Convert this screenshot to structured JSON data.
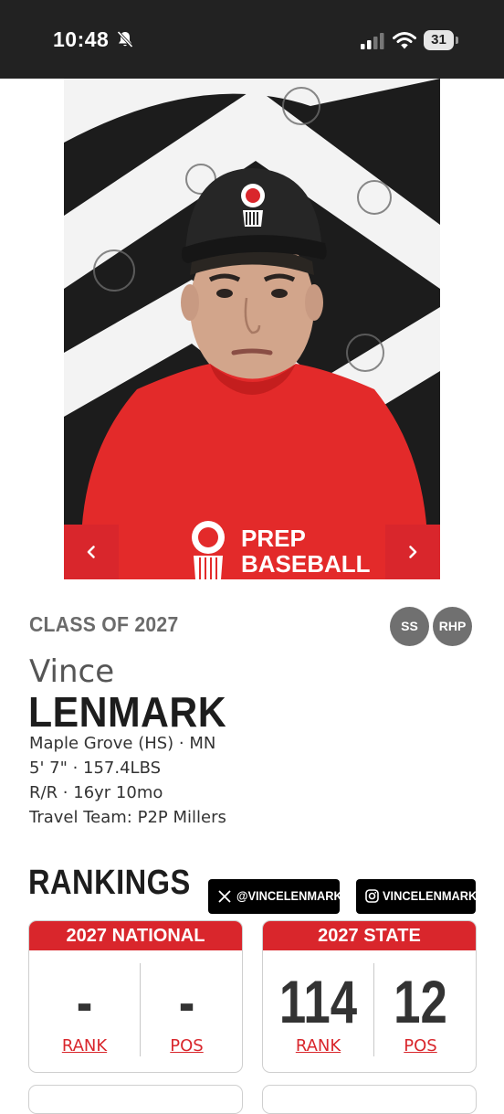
{
  "status_bar": {
    "time": "10:48",
    "battery": "31"
  },
  "player": {
    "class_label": "CLASS OF 2027",
    "positions": [
      "SS",
      "RHP"
    ],
    "first_name": "Vince",
    "last_name": "LENMARK",
    "school": "Maple Grove (HS) · MN",
    "size": "5' 7\" · 157.4LBS",
    "bats_age": "R/R · 16yr 10mo",
    "travel_team": "Travel Team: P2P Millers"
  },
  "photo": {
    "shirt_text_line1": "PREP",
    "shirt_text_line2": "BASEBALL"
  },
  "rankings": {
    "title": "RANKINGS",
    "twitter_handle": "@VINCELENMARK",
    "instagram_handle": "VINCELENMARK",
    "national": {
      "title": "2027 NATIONAL",
      "rank_value": "-",
      "pos_value": "-",
      "rank_label": "RANK",
      "pos_label": "POS"
    },
    "state": {
      "title": "2027 STATE",
      "rank_value": "114",
      "pos_value": "12",
      "rank_label": "RANK",
      "pos_label": "POS"
    }
  },
  "colors": {
    "accent": "#d9262c",
    "badge": "#707070",
    "status_bar": "#222222"
  }
}
